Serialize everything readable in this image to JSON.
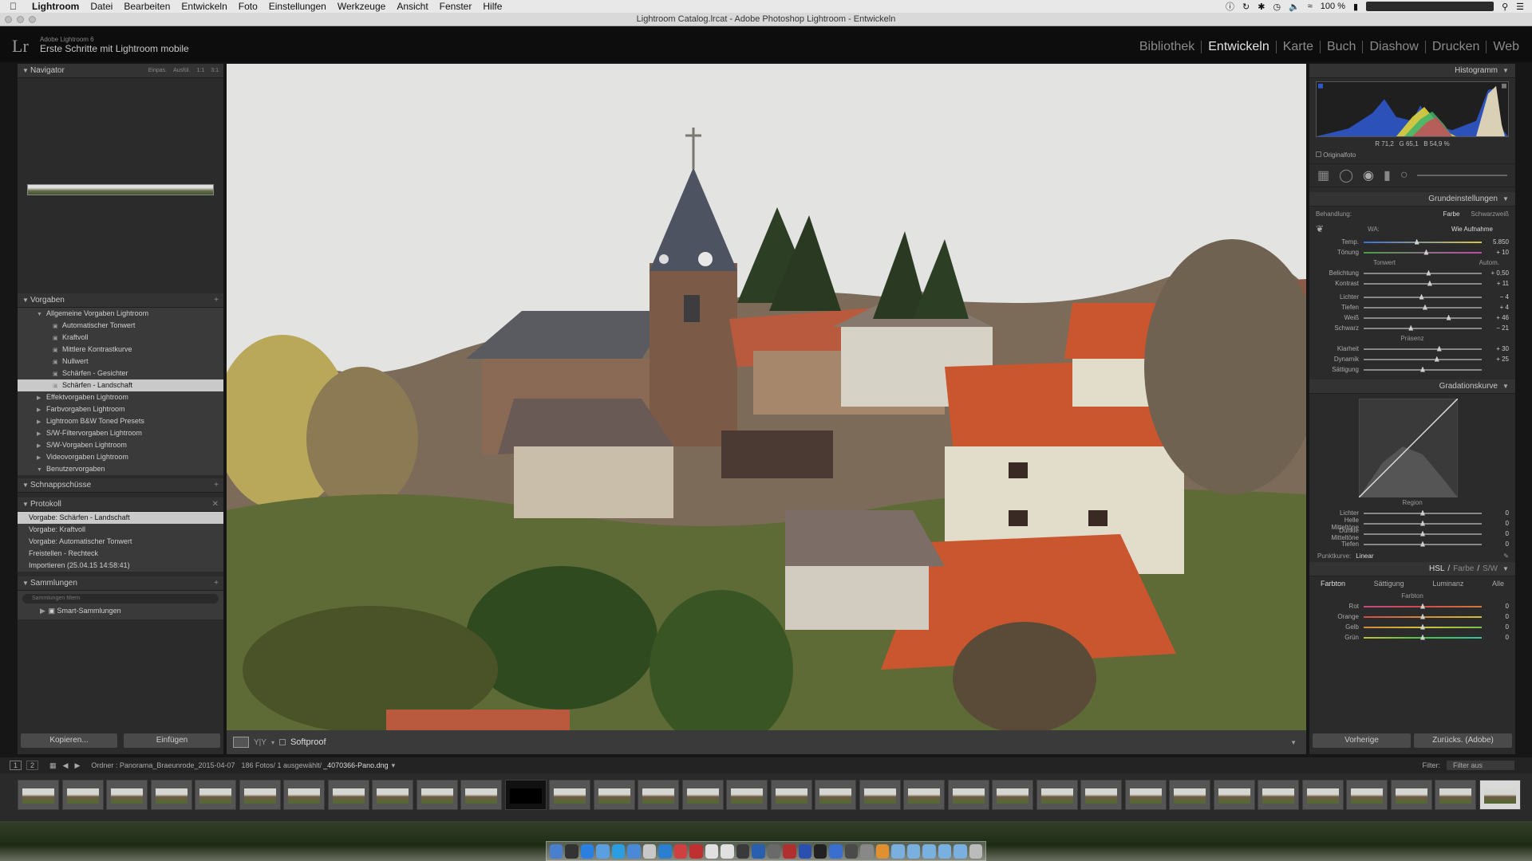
{
  "menubar": {
    "app": "Lightroom",
    "items": [
      "Datei",
      "Bearbeiten",
      "Entwickeln",
      "Foto",
      "Einstellungen",
      "Werkzeuge",
      "Ansicht",
      "Fenster",
      "Hilfe"
    ],
    "battery": "100 %"
  },
  "titlebar": {
    "title": "Lightroom Catalog.lrcat - Adobe Photoshop Lightroom - Entwickeln"
  },
  "identity": {
    "logo": "Lr",
    "version": "Adobe Lightroom 6",
    "subtitle": "Erste Schritte mit Lightroom mobile"
  },
  "modules": [
    "Bibliothek",
    "Entwickeln",
    "Karte",
    "Buch",
    "Diashow",
    "Drucken",
    "Web"
  ],
  "left": {
    "navigator": {
      "title": "Navigator",
      "zoom_options": [
        "Einpas.",
        "Ausfül.",
        "1:1",
        "3:1"
      ]
    },
    "presets": {
      "title": "Vorgaben",
      "items": [
        {
          "label": "Allgemeine Vorgaben Lightroom",
          "level": 1,
          "type": "folder-open"
        },
        {
          "label": "Automatischer Tonwert",
          "level": 2,
          "type": "preset"
        },
        {
          "label": "Kraftvoll",
          "level": 2,
          "type": "preset"
        },
        {
          "label": "Mittlere Kontrastkurve",
          "level": 2,
          "type": "preset"
        },
        {
          "label": "Nullwert",
          "level": 2,
          "type": "preset"
        },
        {
          "label": "Schärfen - Gesichter",
          "level": 2,
          "type": "preset"
        },
        {
          "label": "Schärfen - Landschaft",
          "level": 2,
          "type": "preset",
          "selected": true
        },
        {
          "label": "Effektvorgaben Lightroom",
          "level": 1,
          "type": "folder"
        },
        {
          "label": "Farbvorgaben Lightroom",
          "level": 1,
          "type": "folder"
        },
        {
          "label": "Lightroom B&W Toned Presets",
          "level": 1,
          "type": "folder"
        },
        {
          "label": "S/W-Filtervorgaben Lightroom",
          "level": 1,
          "type": "folder"
        },
        {
          "label": "S/W-Vorgaben Lightroom",
          "level": 1,
          "type": "folder"
        },
        {
          "label": "Videovorgaben Lightroom",
          "level": 1,
          "type": "folder"
        },
        {
          "label": "Benutzervorgaben",
          "level": 1,
          "type": "folder-open"
        }
      ]
    },
    "snapshots": {
      "title": "Schnappschüsse"
    },
    "history": {
      "title": "Protokoll",
      "items": [
        {
          "label": "Vorgabe: Schärfen - Landschaft",
          "selected": true
        },
        {
          "label": "Vorgabe: Kraftvoll"
        },
        {
          "label": "Vorgabe: Automatischer Tonwert"
        },
        {
          "label": "Freistellen - Rechteck"
        },
        {
          "label": "Importieren (25.04.15 14:58:41)"
        }
      ]
    },
    "collections": {
      "title": "Sammlungen",
      "search_placeholder": "Sammlungen filtern",
      "items": [
        "Smart-Sammlungen"
      ]
    },
    "buttons": {
      "copy": "Kopieren...",
      "paste": "Einfügen"
    }
  },
  "toolbar": {
    "softproof": "Softproof"
  },
  "right": {
    "histogram": {
      "title": "Histogramm",
      "r": "71,2",
      "g": "65,1",
      "b": "54,9",
      "unit": "%",
      "original": "Originalfoto"
    },
    "basic": {
      "title": "Grundeinstellungen",
      "treatment_label": "Behandlung:",
      "treatment_color": "Farbe",
      "treatment_bw": "Schwarzweiß",
      "wb_label": "WA:",
      "wb_value": "Wie Aufnahme",
      "wb_sliders": [
        {
          "label": "Temp.",
          "value": "5.850",
          "pos": 0.45
        },
        {
          "label": "Tönung",
          "value": "+ 10",
          "pos": 0.53
        }
      ],
      "tone_label": "Tonwert",
      "auto_label": "Autom.",
      "tone_sliders": [
        {
          "label": "Belichtung",
          "value": "+ 0,50",
          "pos": 0.55
        },
        {
          "label": "Kontrast",
          "value": "+ 11",
          "pos": 0.56
        }
      ],
      "tone_sliders2": [
        {
          "label": "Lichter",
          "value": "− 4",
          "pos": 0.49
        },
        {
          "label": "Tiefen",
          "value": "+ 4",
          "pos": 0.52
        },
        {
          "label": "Weiß",
          "value": "+ 46",
          "pos": 0.72
        },
        {
          "label": "Schwarz",
          "value": "− 21",
          "pos": 0.4
        }
      ],
      "presence_label": "Präsenz",
      "presence_sliders": [
        {
          "label": "Klarheit",
          "value": "+ 30",
          "pos": 0.64
        },
        {
          "label": "Dynamik",
          "value": "+ 25",
          "pos": 0.62
        },
        {
          "label": "Sättigung",
          "value": "",
          "pos": 0.5
        }
      ]
    },
    "curve": {
      "title": "Gradationskurve",
      "region_label": "Region",
      "sliders": [
        {
          "label": "Lichter",
          "value": "0",
          "pos": 0.5
        },
        {
          "label": "Helle Mitteltöne",
          "value": "0",
          "pos": 0.5
        },
        {
          "label": "Dunkle Mitteltöne",
          "value": "0",
          "pos": 0.5
        },
        {
          "label": "Tiefen",
          "value": "0",
          "pos": 0.5
        }
      ],
      "point_curve_label": "Punktkurve:",
      "point_curve_value": "Linear"
    },
    "hsl": {
      "title": "HSL",
      "title_alt1": "Farbe",
      "title_alt2": "S/W",
      "tabs": [
        "Farbton",
        "Sättigung",
        "Luminanz",
        "Alle"
      ],
      "section_label": "Farbton",
      "sliders": [
        {
          "label": "Rot",
          "value": "0",
          "pos": 0.5
        },
        {
          "label": "Orange",
          "value": "0",
          "pos": 0.5
        },
        {
          "label": "Gelb",
          "value": "0",
          "pos": 0.5
        },
        {
          "label": "Grün",
          "value": "0",
          "pos": 0.5
        }
      ]
    },
    "buttons": {
      "previous": "Vorherige",
      "reset": "Zurücks. (Adobe)"
    }
  },
  "filmstrip_bar": {
    "source": "Ordner : Panorama_Braeunrode_2015-04-07",
    "count": "186 Fotos/ 1 ausgewählt/",
    "file": "_4070366-Pano.dng",
    "filter_label": "Filter:",
    "filter_value": "Filter aus"
  },
  "colors": {
    "accent": "#e6e6e6",
    "panel": "#2b2b2b",
    "background": "#161616"
  }
}
